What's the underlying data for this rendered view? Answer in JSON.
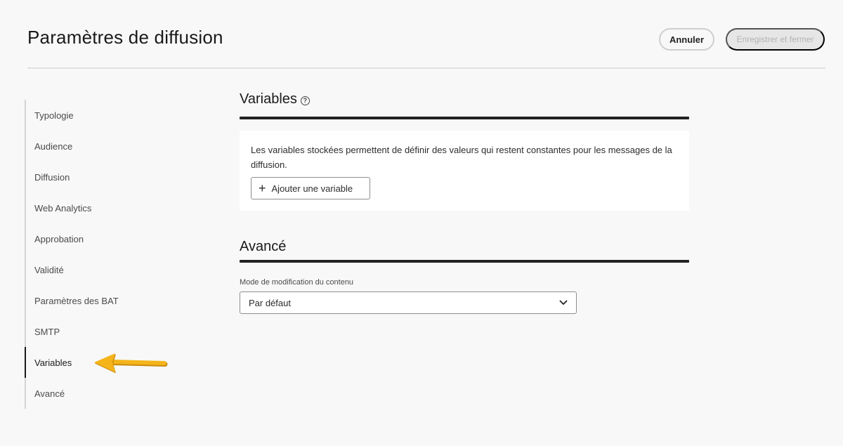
{
  "header": {
    "title": "Paramètres de diffusion",
    "cancel_label": "Annuler",
    "save_label": "Enregistrer et fermer"
  },
  "sidebar": {
    "items": [
      {
        "label": "Typologie"
      },
      {
        "label": "Audience"
      },
      {
        "label": "Diffusion"
      },
      {
        "label": "Web Analytics"
      },
      {
        "label": "Approbation"
      },
      {
        "label": "Validité"
      },
      {
        "label": "Paramètres des BAT"
      },
      {
        "label": "SMTP"
      },
      {
        "label": "Variables",
        "active": true
      },
      {
        "label": "Avancé"
      }
    ]
  },
  "variables": {
    "title": "Variables",
    "help_icon": "help-icon",
    "description": "Les variables stockées permettent de définir des valeurs qui restent constantes pour les messages de la diffusion.",
    "add_label": "Ajouter une variable"
  },
  "advanced": {
    "title": "Avancé",
    "field_label": "Mode de modification du contenu",
    "select_value": "Par défaut"
  },
  "colors": {
    "accent_arrow": "#f4b41a",
    "active_indicator": "#1a1a1a"
  }
}
